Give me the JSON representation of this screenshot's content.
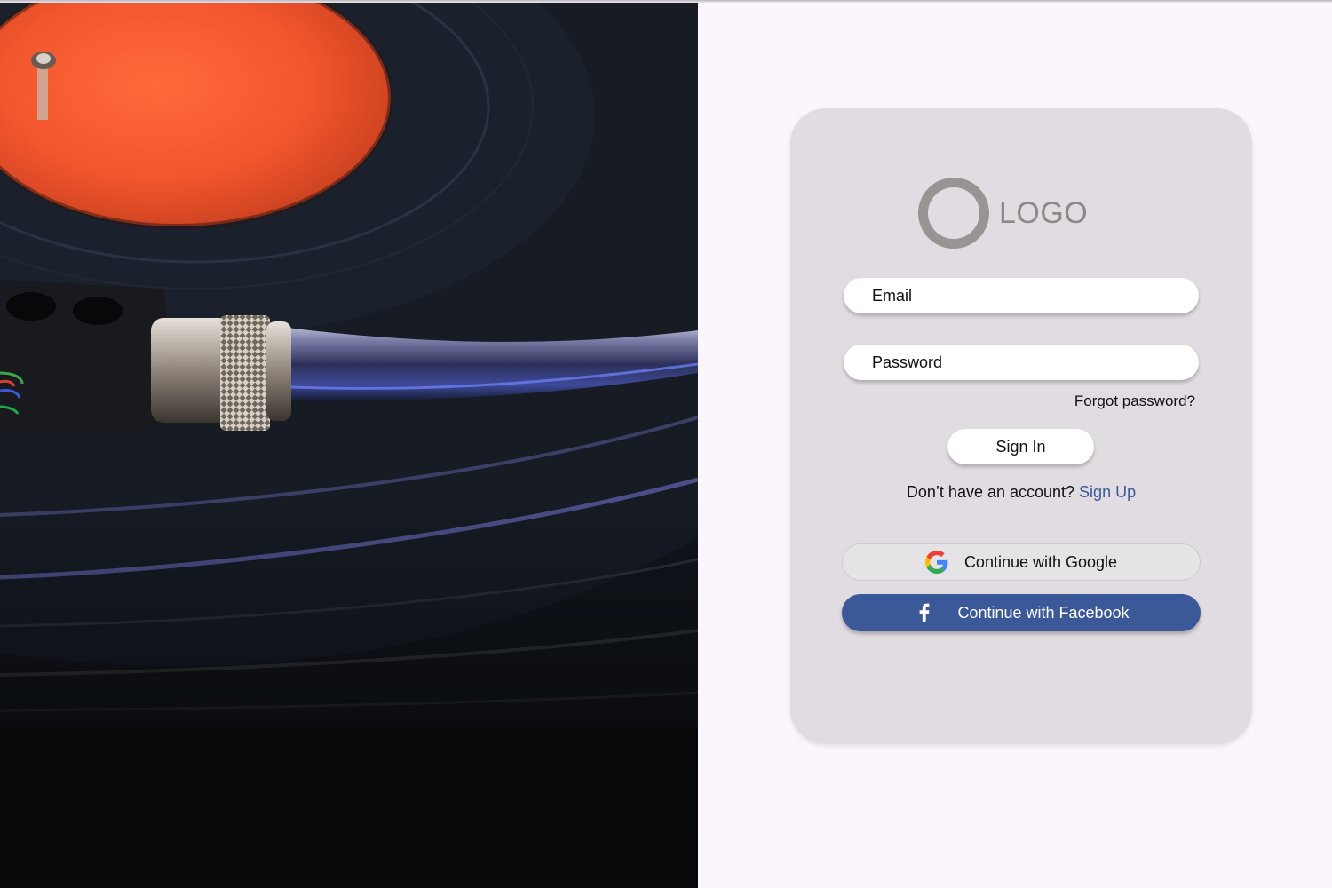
{
  "logo": {
    "text": "LOGO"
  },
  "form": {
    "email_placeholder": "Email",
    "password_placeholder": "Password",
    "forgot_password": "Forgot password?",
    "sign_in_label": "Sign In",
    "no_account_text": "Don’t have an account? ",
    "sign_up_link": "Sign Up"
  },
  "social": {
    "google_label": "Continue with Google",
    "google_icon": "google-g-icon",
    "facebook_label": "Continue with Facebook",
    "facebook_icon": "facebook-f-icon"
  },
  "colors": {
    "page_background": "#fbf5fd",
    "card_background": "#e0dce1",
    "facebook_blue": "#3b5998",
    "link_blue": "#3d5a99",
    "logo_gray": "#9a9394"
  }
}
